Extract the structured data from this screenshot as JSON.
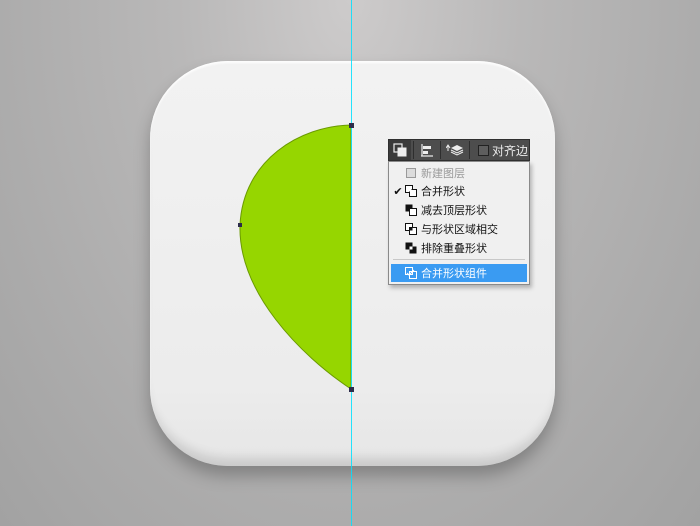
{
  "toolbar": {
    "buttons": [
      "path-operations-icon",
      "path-alignment-icon",
      "path-arrangement-icon"
    ],
    "align_edges_label": "对齐边"
  },
  "menu": {
    "items": [
      {
        "label": "新建图层",
        "checked": false,
        "disabled": true,
        "selected": false,
        "icon": "new-layer-icon"
      },
      {
        "label": "合并形状",
        "checked": true,
        "disabled": false,
        "selected": false,
        "icon": "combine-shapes-icon"
      },
      {
        "label": "减去顶层形状",
        "checked": false,
        "disabled": false,
        "selected": false,
        "icon": "subtract-front-shape-icon"
      },
      {
        "label": "与形状区域相交",
        "checked": false,
        "disabled": false,
        "selected": false,
        "icon": "intersect-shape-areas-icon"
      },
      {
        "label": "排除重叠形状",
        "checked": false,
        "disabled": false,
        "selected": false,
        "icon": "exclude-overlapping-shapes-icon"
      }
    ],
    "merge_item": {
      "label": "合并形状组件",
      "selected": true,
      "icon": "merge-shape-components-icon"
    },
    "check_glyph": "✔"
  },
  "colors": {
    "shape_fill": "#96d600",
    "guide": "#00e0ff",
    "menu_selection": "#3a9bf2"
  }
}
